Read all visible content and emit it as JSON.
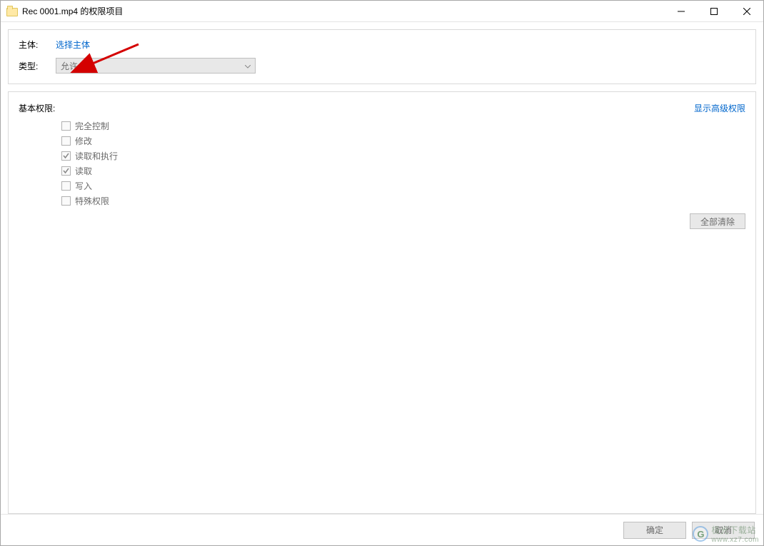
{
  "title": "Rec 0001.mp4 的权限项目",
  "principal": {
    "label": "主体:",
    "link": "选择主体"
  },
  "type": {
    "label": "类型:",
    "value": "允许"
  },
  "permissions": {
    "title": "基本权限:",
    "advanced_link": "显示高级权限",
    "items": [
      {
        "label": "完全控制",
        "checked": false
      },
      {
        "label": "修改",
        "checked": false
      },
      {
        "label": "读取和执行",
        "checked": true
      },
      {
        "label": "读取",
        "checked": true
      },
      {
        "label": "写入",
        "checked": false
      },
      {
        "label": "特殊权限",
        "checked": false
      }
    ],
    "clear_all": "全部清除"
  },
  "buttons": {
    "ok": "确定",
    "cancel": "取消"
  },
  "watermark": {
    "g": "G",
    "text1": "极光下载站",
    "text2": "www.xz7.com"
  }
}
